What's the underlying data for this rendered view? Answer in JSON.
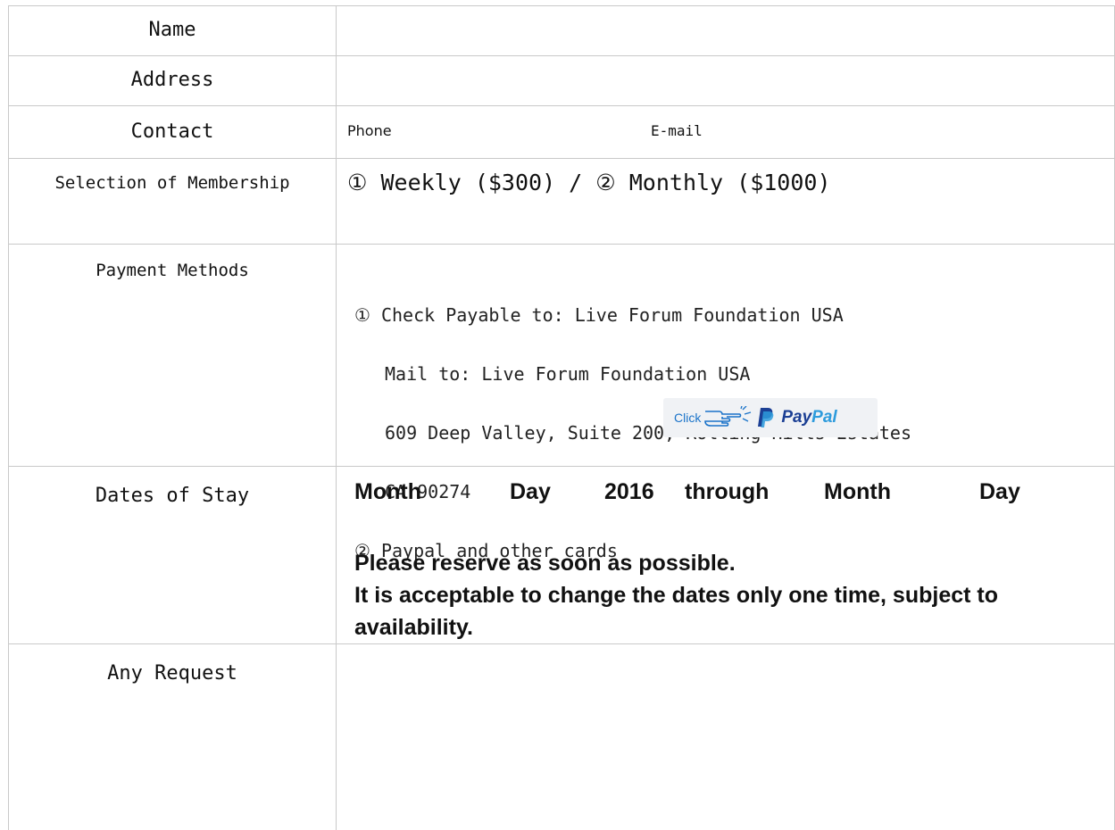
{
  "form": {
    "name_label": "Name",
    "address_label": "Address",
    "contact_label": "Contact",
    "contact_phone": "Phone",
    "contact_email": "E-mail",
    "membership_label": "Selection of Membership",
    "membership_options": "① Weekly ($300) / ② Monthly ($1000)",
    "payment_label": "Payment Methods",
    "payment": {
      "line1": "① Check Payable to: Live Forum Foundation USA",
      "line2": "Mail to: Live Forum Foundation USA",
      "line3": "609 Deep Valley, Suite 200, Rolling Hills Estates",
      "line4": "CA 90274",
      "line5": "② Paypal and other cards"
    },
    "paypal_button": {
      "click_text": "Click",
      "pay": "Pay",
      "pal": "Pal"
    },
    "dates_label": "Dates of Stay",
    "dates": {
      "month1": "Month",
      "day1": "Day",
      "year": "2016",
      "through": "through",
      "month2": "Month",
      "day2": "Day",
      "note1": "Please reserve as soon as possible.",
      "note2": "It is acceptable to change the dates only one time, subject to availability."
    },
    "request_label": "Any Request"
  },
  "colors": {
    "border": "#c9c9c9",
    "paypal_dark": "#1b3f94",
    "paypal_light": "#2d9bdc",
    "click_blue": "#1a73c9"
  }
}
